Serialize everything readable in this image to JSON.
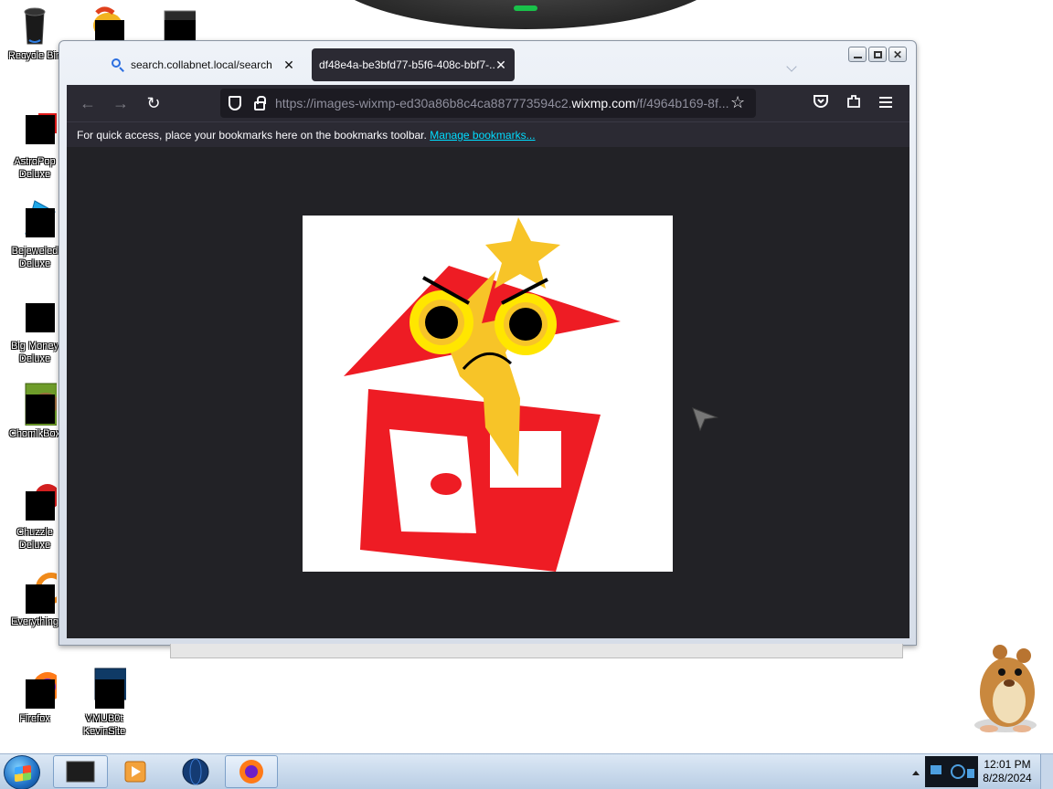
{
  "desktop": {
    "icons": [
      {
        "label": "Recycle Bin",
        "icon": "recycle-bin-icon"
      },
      {
        "label": "AstroPop Deluxe",
        "icon": "astropop-icon"
      },
      {
        "label": "Bejeweled Deluxe",
        "icon": "bejeweled-icon"
      },
      {
        "label": "Big Money Deluxe",
        "icon": "money-bag-icon"
      },
      {
        "label": "ChomikBox",
        "icon": "chomikbox-icon"
      },
      {
        "label": "Chuzzle Deluxe",
        "icon": "chuzzle-icon"
      },
      {
        "label": "Everything",
        "icon": "everything-icon"
      },
      {
        "label": "Firefox",
        "icon": "firefox-icon"
      },
      {
        "label": "VMUB0t KevinSite",
        "icon": "monitor-icon"
      }
    ]
  },
  "browser": {
    "tabs": [
      {
        "title": "search.collabnet.local/search",
        "icon": "search-icon",
        "active": false
      },
      {
        "title": "df48e4a-be3bfd77-b5f6-408c-bbf7-...",
        "icon": "",
        "active": true
      }
    ],
    "url": {
      "prefix": "https://images-wixmp-ed30a86b8c4ca887773594c2.",
      "domain": "wixmp.com",
      "suffix": "/f/4964b169-8f..."
    },
    "bookmarks_bar": {
      "message": "For quick access, place your bookmarks here on the bookmarks toolbar.",
      "link": "Manage bookmarks..."
    },
    "image_content": "red-house-with-angry-yellow-face"
  },
  "taskbar": {
    "time": "12:01 PM",
    "date": "8/28/2024"
  },
  "colors": {
    "browser_dark": "#2b2a33",
    "content_bg": "#222226",
    "link": "#00ddff",
    "drawing_red": "#ee1c24",
    "drawing_yellow": "#ffd700"
  }
}
